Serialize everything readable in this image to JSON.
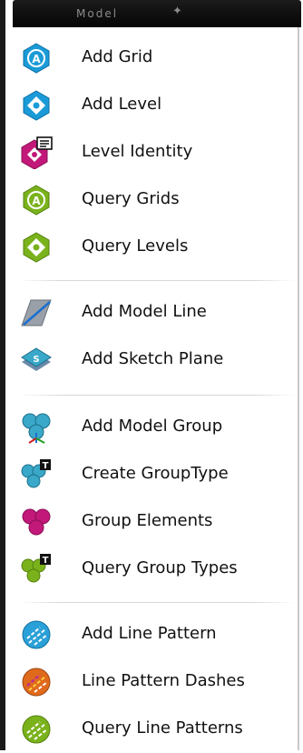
{
  "panel": {
    "title": "Model",
    "pin_glyph": "✦"
  },
  "groups": [
    {
      "items": [
        {
          "label": "Add Grid"
        },
        {
          "label": "Add Level"
        },
        {
          "label": "Level Identity"
        },
        {
          "label": "Query Grids"
        },
        {
          "label": "Query Levels"
        }
      ]
    },
    {
      "items": [
        {
          "label": "Add Model Line"
        },
        {
          "label": "Add Sketch Plane"
        }
      ]
    },
    {
      "items": [
        {
          "label": "Add Model Group"
        },
        {
          "label": "Create GroupType"
        },
        {
          "label": "Group Elements"
        },
        {
          "label": "Query Group Types"
        }
      ]
    },
    {
      "items": [
        {
          "label": "Add Line Pattern"
        },
        {
          "label": "Line Pattern Dashes"
        },
        {
          "label": "Query Line Patterns"
        }
      ]
    }
  ],
  "colors": {
    "grid_blue": "#1a9bd7",
    "level_magenta": "#c2187a",
    "query_green": "#7ab21c",
    "model_gray": "#8a9098",
    "group_teal": "#3aa8c8",
    "pattern_orange": "#e06a1c"
  }
}
